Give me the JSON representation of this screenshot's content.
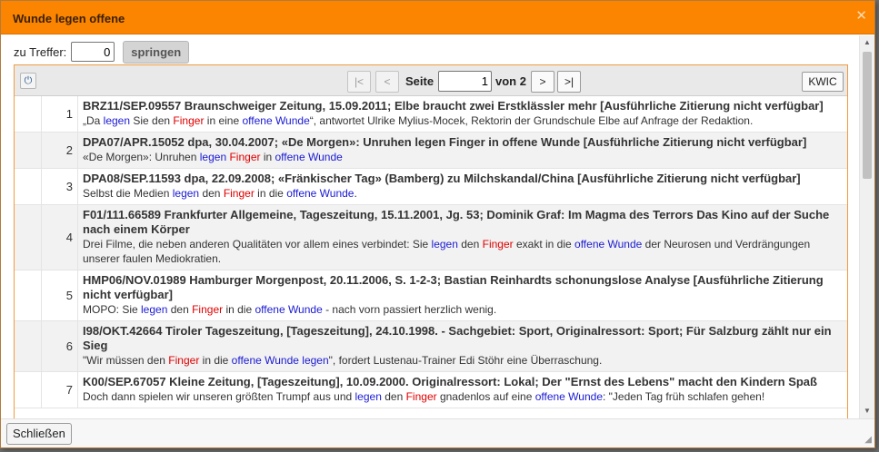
{
  "dialog": {
    "title": "Wunde legen offene",
    "close_icon": "close-icon"
  },
  "jump": {
    "label": "zu Treffer:",
    "value": "0",
    "button": "springen"
  },
  "pager": {
    "first": "|<",
    "prev": "<",
    "page_label": "Seite",
    "page_value": "1",
    "of_label": "von 2",
    "next": ">",
    "last": ">|",
    "kwic": "KWIC"
  },
  "results": [
    {
      "num": "1",
      "source": "BRZ11/SEP.09557 Braunschweiger Zeitung, 15.09.2011; Elbe braucht zwei Erstklässler mehr [Ausführliche Zitierung nicht verfügbar]",
      "k0": "„Da ",
      "k1": "legen",
      "k2": " Sie den ",
      "k3": "Finger",
      "k4": " in eine ",
      "k5": "offene Wunde",
      "k6": "“, antwortet Ulrike Mylius-Mocek, Rektorin der Grundschule Elbe auf Anfrage der Redaktion."
    },
    {
      "num": "2",
      "source": "DPA07/APR.15052 dpa, 30.04.2007; «De Morgen»: Unruhen legen Finger in offene Wunde [Ausführliche Zitierung nicht verfügbar]",
      "k0": "«De Morgen»: Unruhen ",
      "k1": "legen",
      "k2": " ",
      "k3": "Finger",
      "k4": " in ",
      "k5": "offene Wunde",
      "k6": ""
    },
    {
      "num": "3",
      "source": "DPA08/SEP.11593 dpa, 22.09.2008; «Fränkischer Tag» (Bamberg) zu Milchskandal/China [Ausführliche Zitierung nicht verfügbar]",
      "k0": "Selbst die Medien ",
      "k1": "legen",
      "k2": " den ",
      "k3": "Finger",
      "k4": " in die ",
      "k5": "offene Wunde",
      "k6": "."
    },
    {
      "num": "4",
      "source": "F01/111.66589 Frankfurter Allgemeine, Tageszeitung, 15.11.2001, Jg. 53; Dominik Graf: Im Magma des Terrors Das Kino auf der Suche nach einem Körper",
      "k0": "Drei Filme, die neben anderen Qualitäten vor allem eines verbindet: Sie ",
      "k1": "legen",
      "k2": " den ",
      "k3": "Finger",
      "k4": " exakt in die ",
      "k5": "offene Wunde",
      "k6": " der Neurosen und Verdrängungen unserer faulen Mediokratien."
    },
    {
      "num": "5",
      "source": "HMP06/NOV.01989 Hamburger Morgenpost, 20.11.2006, S. 1-2-3; Bastian Reinhardts schonungslose Analyse [Ausführliche Zitierung nicht verfügbar]",
      "k0": "MOPO: Sie ",
      "k1": "legen",
      "k2": " den ",
      "k3": "Finger",
      "k4": " in die ",
      "k5": "offene Wunde",
      "k6": " - nach vorn passiert herzlich wenig."
    },
    {
      "num": "6",
      "source": "I98/OKT.42664 Tiroler Tageszeitung, [Tageszeitung], 24.10.1998. - Sachgebiet: Sport, Originalressort: Sport; Für Salzburg zählt nur ein Sieg",
      "k0": "\"Wir müssen den ",
      "k1": "Finger",
      "k2": " in die ",
      "k3": "offene Wunde legen",
      "k4": "\", fordert Lustenau-Trainer Edi Stöhr eine Überraschung.",
      "k5": "",
      "k6": ""
    },
    {
      "num": "7",
      "source": "K00/SEP.67057 Kleine Zeitung, [Tageszeitung], 10.09.2000. Originalressort: Lokal; Der \"Ernst des Lebens\" macht den Kindern Spaß",
      "k0": "Doch dann spielen wir unseren größten Trumpf aus und ",
      "k1": "legen",
      "k2": " den ",
      "k3": "Finger",
      "k4": " gnadenlos auf eine ",
      "k5": "offene Wunde",
      "k6": ": \"Jeden Tag früh schlafen gehen!"
    }
  ],
  "footer": {
    "close_button": "Schließen"
  },
  "colors": {
    "titlebar": "#fb8500",
    "keyword_blue": "#1a1ad4",
    "keyword_red": "#e00000"
  }
}
